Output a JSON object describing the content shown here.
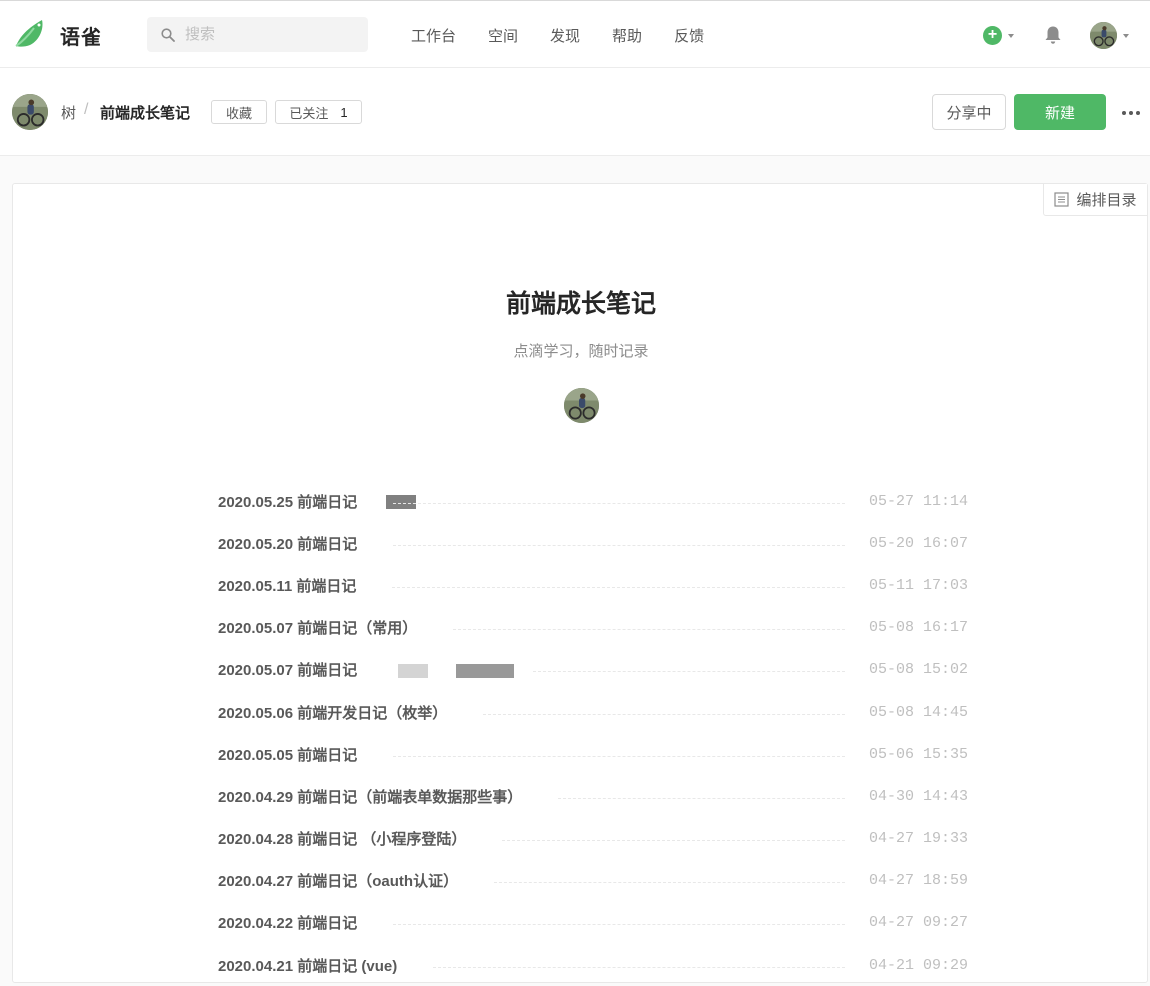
{
  "app": {
    "brand": "语雀",
    "search_placeholder": "搜索",
    "nav": [
      "工作台",
      "空间",
      "发现",
      "帮助",
      "反馈"
    ],
    "colors": {
      "accent": "#4fb866",
      "text": "#262626",
      "muted": "#8c8c8c"
    }
  },
  "book": {
    "user": "树",
    "separator": "/",
    "name": "前端成长笔记",
    "fav_label": "收藏",
    "follow_label": "已关注",
    "follow_count": "1",
    "share_label": "分享中",
    "new_label": "新建"
  },
  "content": {
    "toc_edit_label": "编排目录",
    "title": "前端成长笔记",
    "subtitle": "点滴学习，随时记录",
    "docs": [
      {
        "title": "2020.05.25 前端日记",
        "time": "05-27 11:14"
      },
      {
        "title": "2020.05.20 前端日记",
        "time": "05-20 16:07"
      },
      {
        "title": "2020.05.11 前端日记",
        "time": "05-11 17:03"
      },
      {
        "title": "2020.05.07 前端日记（常用）",
        "time": "05-08 16:17"
      },
      {
        "title": "2020.05.07 前端日记",
        "time": "05-08 15:02"
      },
      {
        "title": "2020.05.06 前端开发日记（枚举）",
        "time": "05-08 14:45"
      },
      {
        "title": "2020.05.05 前端日记",
        "time": "05-06 15:35"
      },
      {
        "title": "2020.04.29 前端日记（前端表单数据那些事）",
        "time": "04-30 14:43"
      },
      {
        "title": "2020.04.28 前端日记 （小程序登陆）",
        "time": "04-27 19:33"
      },
      {
        "title": "2020.04.27 前端日记（oauth认证）",
        "time": "04-27 18:59"
      },
      {
        "title": "2020.04.22 前端日记",
        "time": "04-27 09:27"
      },
      {
        "title": "2020.04.21 前端日记 (vue)",
        "time": "04-21 09:29"
      }
    ]
  }
}
